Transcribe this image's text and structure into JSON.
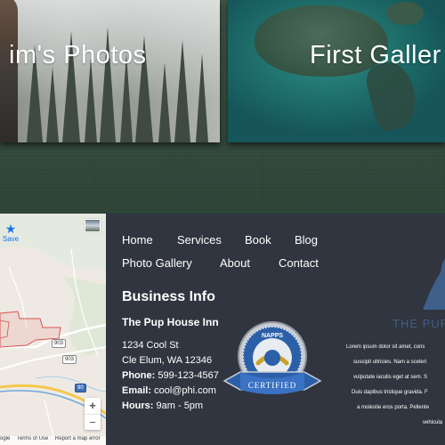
{
  "gallery": {
    "left_tile_title": "im's Photos",
    "right_tile_title": "First Galler"
  },
  "map": {
    "save_label": "Save",
    "zoom_in": "+",
    "zoom_out": "−",
    "route_903": "903",
    "route_90": "90",
    "footer_links": [
      "ogle",
      "Terms of Use",
      "Report a map error"
    ]
  },
  "footer": {
    "nav": [
      "Home",
      "Services",
      "Book",
      "Blog",
      "Photo Gallery",
      "About",
      "Contact"
    ],
    "business_info_title": "Business Info",
    "business_name": "The Pup House Inn",
    "address_line1": "1234 Cool St",
    "address_line2": "Cle Elum, WA 12346",
    "phone_label": "Phone:",
    "phone": "599-123-4567",
    "email_label": "Email:",
    "email": "cool@phi.com",
    "hours_label": "Hours:",
    "hours": "9am - 5pm",
    "badge_top": "NAPPS",
    "badge_ribbon": "CERTIFIED",
    "logo_text": "THE PUP",
    "lorem_lines": [
      "Lorem ipsum dolor sit amet, cons",
      "suscipit ultricies. Nam a sceleri",
      "vulputate iaculis eget at sem. S",
      "Duis dapibus tristique gravida. F",
      "a molestie eros porta. Pellente",
      "vehicula"
    ]
  },
  "colors": {
    "footer_bg": "#30353f",
    "accent_blue": "#1a73e8",
    "logo_blue": "#3d5f8a"
  }
}
